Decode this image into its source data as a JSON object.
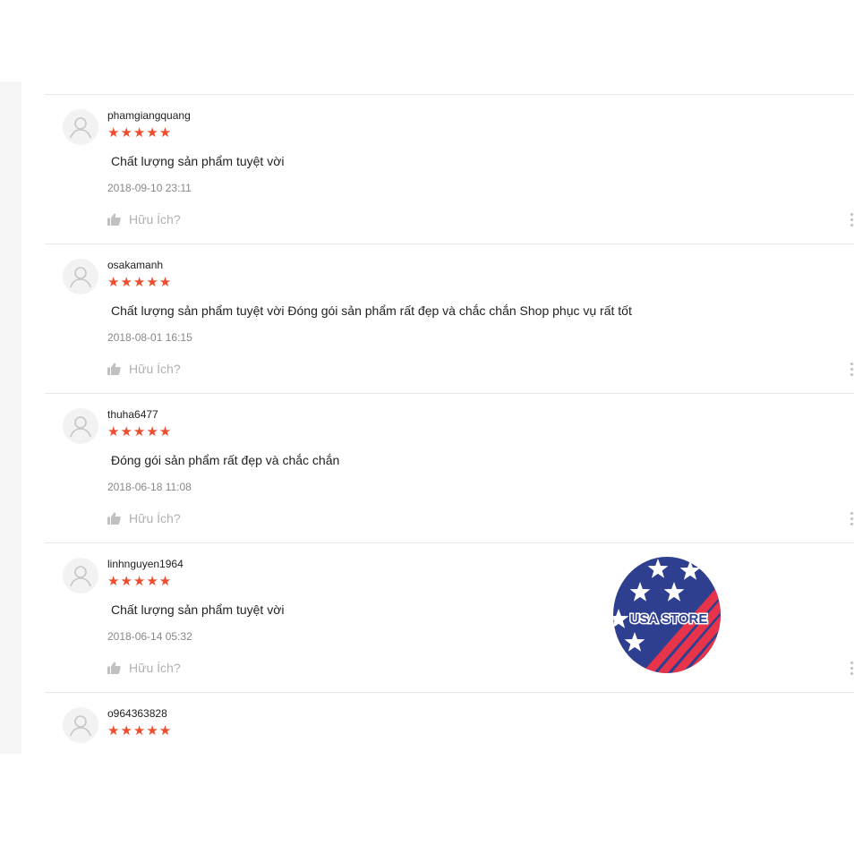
{
  "reviews": [
    {
      "username": "phamgiangquang",
      "rating": 5,
      "stars": "★★★★★",
      "comment": "Chất lượng sản phẩm tuyệt vời",
      "date": "2018-09-10 23:11",
      "helpful_label": "Hữu Ích?"
    },
    {
      "username": "osakamanh",
      "rating": 5,
      "stars": "★★★★★",
      "comment": "Chất lượng sản phẩm tuyệt vời Đóng gói sản phẩm rất đẹp và chắc chắn Shop phục vụ rất tốt",
      "date": "2018-08-01 16:15",
      "helpful_label": "Hữu Ích?"
    },
    {
      "username": "thuha6477",
      "rating": 5,
      "stars": "★★★★★",
      "comment": "Đóng gói sản phẩm rất đẹp và chắc chắn",
      "date": "2018-06-18 11:08",
      "helpful_label": "Hữu Ích?"
    },
    {
      "username": "linhnguyen1964",
      "rating": 5,
      "stars": "★★★★★",
      "comment": "Chất lượng sản phẩm tuyệt vời",
      "date": "2018-06-14 05:32",
      "helpful_label": "Hữu Ích?"
    },
    {
      "username": "o964363828",
      "rating": 5,
      "stars": "★★★★★"
    }
  ],
  "badge": {
    "text": "USA STORE",
    "colors": {
      "blue": "#2f3f8f",
      "red": "#e8344a",
      "white": "#ffffff"
    }
  },
  "colors": {
    "star": "#ee4d2d",
    "muted": "#888888",
    "divider": "#e8e8e8"
  },
  "icons": {
    "avatar": "user-icon",
    "helpful": "thumbs-up-icon",
    "more": "more-vertical-icon"
  }
}
